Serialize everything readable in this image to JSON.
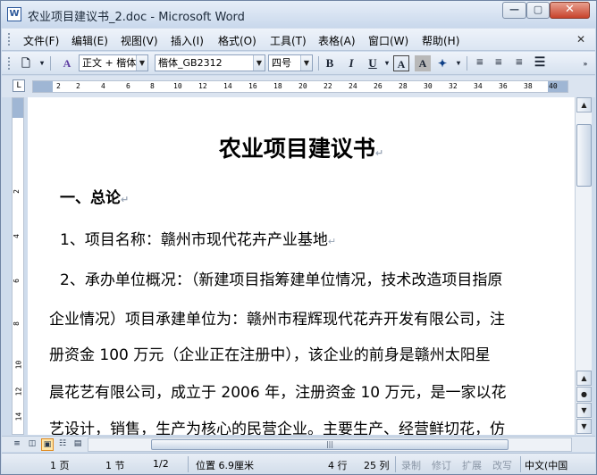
{
  "window": {
    "title": "农业项目建议书_2.doc - Microsoft Word",
    "app_icon_glyph": "W",
    "minimize_glyph": "—",
    "maximize_glyph": "▢",
    "close_glyph": "✕"
  },
  "menu": {
    "items": [
      "文件(F)",
      "编辑(E)",
      "视图(V)",
      "插入(I)",
      "格式(O)",
      "工具(T)",
      "表格(A)",
      "窗口(W)",
      "帮助(H)"
    ],
    "close_doc_glyph": "✕"
  },
  "toolbar": {
    "style_value": "正文 + 楷体",
    "font_value": "楷体_GB2312",
    "size_value": "四号",
    "bold_label": "B",
    "italic_label": "I",
    "underline_label": "U",
    "border_label": "A",
    "shading_label": "A"
  },
  "ruler": {
    "ticks": [
      "2",
      "2",
      "4",
      "6",
      "8",
      "10",
      "12",
      "14",
      "16",
      "18",
      "20",
      "22",
      "24",
      "26",
      "28",
      "30",
      "32",
      "34",
      "36",
      "38",
      "40"
    ],
    "vticks": [
      "2",
      "4",
      "6",
      "8",
      "10",
      "12",
      "14"
    ]
  },
  "document": {
    "title": "农业项目建议书",
    "paragraphs": [
      "一、总论",
      "1、项目名称：赣州市现代花卉产业基地",
      "2、承办单位概况：（新建项目指筹建单位情况，技术改造项目指原",
      "企业情况）项目承建单位为：赣州市程辉现代花卉开发有限公司，注",
      "册资金 100 万元（企业正在注册中），该企业的前身是赣州太阳星",
      "晨花艺有限公司，成立于 2006 年，注册资金 10 万元，是一家以花",
      "艺设计，销售，生产为核心的民营企业。主要生产、经营鲜切花，仿"
    ],
    "para_mark": "↵"
  },
  "statusbar": {
    "page": "1 页",
    "section": "1 节",
    "page_of": "1/2",
    "position": "位置 6.9厘米",
    "line": "4 行",
    "column": "25 列",
    "rec": "录制",
    "trk": "修订",
    "ext": "扩展",
    "ovr": "改写",
    "language": "中文(中国"
  }
}
